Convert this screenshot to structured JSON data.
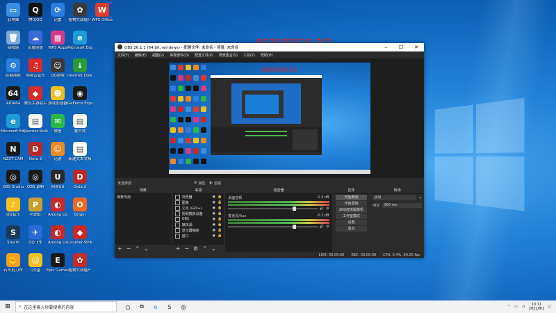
{
  "desktop": {
    "icons": [
      {
        "label": "此电脑",
        "color": "#3a8de0",
        "glyph": "▭",
        "col": 0,
        "row": 0
      },
      {
        "label": "腾讯QQ",
        "color": "#111111",
        "glyph": "Q",
        "col": 1,
        "row": 0
      },
      {
        "label": "迅雷",
        "color": "#2a7de1",
        "glyph": "⟳",
        "col": 2,
        "row": 0
      },
      {
        "label": "植物大战僵尸",
        "color": "#3a3a3a",
        "glyph": "✿",
        "col": 3,
        "row": 0
      },
      {
        "label": "WPS Office",
        "color": "#e03a2f",
        "glyph": "W",
        "col": 4,
        "row": 0
      },
      {
        "label": "回收站",
        "color": "#7aa8d8",
        "glyph": "🗑",
        "col": 0,
        "row": 1
      },
      {
        "label": "百度网盘",
        "color": "#3a6ad8",
        "glyph": "☁",
        "col": 1,
        "row": 1
      },
      {
        "label": "WPS Apps",
        "color": "#d83a8a",
        "glyph": "▦",
        "col": 2,
        "row": 1
      },
      {
        "label": "Microsoft Edge",
        "color": "#1f9ad8",
        "glyph": "e",
        "col": 3,
        "row": 1
      },
      {
        "label": "控制面板",
        "color": "#2a7de1",
        "glyph": "⚙",
        "col": 0,
        "row": 2
      },
      {
        "label": "网易云音乐",
        "color": "#d82a2a",
        "glyph": "♫",
        "col": 1,
        "row": 2
      },
      {
        "label": "QQ游戏",
        "color": "#3a3a3a",
        "glyph": "☺",
        "col": 2,
        "row": 2
      },
      {
        "label": "Internet Download",
        "color": "#2a9a3a",
        "glyph": "↓",
        "col": 3,
        "row": 2
      },
      {
        "label": "AIDA64",
        "color": "#1a1a1a",
        "glyph": "64",
        "col": 0,
        "row": 3
      },
      {
        "label": "腾讯手游助手",
        "color": "#d82a2a",
        "glyph": "◆",
        "col": 1,
        "row": 3
      },
      {
        "label": "游戏加速器",
        "color": "#f0c020",
        "glyph": "☻",
        "col": 2,
        "row": 3
      },
      {
        "label": "GeForce Experience",
        "color": "#1a1a1a",
        "glyph": "◉",
        "col": 3,
        "row": 3
      },
      {
        "label": "Microsoft Edge",
        "color": "#1f9ad8",
        "glyph": "e",
        "col": 0,
        "row": 4
      },
      {
        "label": "Counter-Strike",
        "color": "#ffffff",
        "glyph": "▤",
        "col": 1,
        "row": 4
      },
      {
        "label": "微信",
        "color": "#2ab84a",
        "glyph": "✉",
        "col": 2,
        "row": 4
      },
      {
        "label": "鲁大师",
        "color": "#ffffff",
        "glyph": "▤",
        "col": 3,
        "row": 4
      },
      {
        "label": "NZXT CAM",
        "color": "#1a1a1a",
        "glyph": "N",
        "col": 0,
        "row": 5
      },
      {
        "label": "Dota 2",
        "color": "#b82a2a",
        "glyph": "D",
        "col": 1,
        "row": 5
      },
      {
        "label": "迅游",
        "color": "#f08a20",
        "glyph": "☺",
        "col": 2,
        "row": 5
      },
      {
        "label": "新建文本文档",
        "color": "#ffffff",
        "glyph": "▤",
        "col": 3,
        "row": 5
      },
      {
        "label": "OBS Studio",
        "color": "#1a1a1a",
        "glyph": "◎",
        "col": 0,
        "row": 6
      },
      {
        "label": "OBS 录制",
        "color": "#1a1a1a",
        "glyph": "◎",
        "col": 1,
        "row": 6
      },
      {
        "label": "网易UU",
        "color": "#2a2a2a",
        "glyph": "U",
        "col": 2,
        "row": 6
      },
      {
        "label": "Dota 2",
        "color": "#b82a2a",
        "glyph": "D",
        "col": 3,
        "row": 6
      },
      {
        "label": "QQ音乐",
        "color": "#f0c020",
        "glyph": "♪",
        "col": 0,
        "row": 7
      },
      {
        "label": "PUBG",
        "color": "#c8a030",
        "glyph": "P",
        "col": 1,
        "row": 7
      },
      {
        "label": "Among Us",
        "color": "#c82a2a",
        "glyph": "◐",
        "col": 2,
        "row": 7
      },
      {
        "label": "Origin",
        "color": "#f06a20",
        "glyph": "O",
        "col": 3,
        "row": 7
      },
      {
        "label": "Steam",
        "color": "#1a3a5a",
        "glyph": "S",
        "col": 0,
        "row": 8
      },
      {
        "label": "QQ飞车",
        "color": "#2a6ad8",
        "glyph": "✈",
        "col": 1,
        "row": 8
      },
      {
        "label": "Among Us",
        "color": "#c82a2a",
        "glyph": "◐",
        "col": 2,
        "row": 8
      },
      {
        "label": "Counter-Strike",
        "color": "#c82a2a",
        "glyph": "◆",
        "col": 3,
        "row": 8
      },
      {
        "label": "石头剪刀布",
        "color": "#f0a020",
        "glyph": "✊",
        "col": 0,
        "row": 9
      },
      {
        "label": "QQ堂",
        "color": "#f0c020",
        "glyph": "☺",
        "col": 1,
        "row": 9
      },
      {
        "label": "Epic Games",
        "color": "#1a1a1a",
        "glyph": "E",
        "col": 2,
        "row": 9
      },
      {
        "label": "植物大战僵尸",
        "color": "#c82a2a",
        "glyph": "✿",
        "col": 3,
        "row": 9
      }
    ]
  },
  "counter_text": "8930/9500 3/2",
  "obs": {
    "title": "OBS 26.1.1 (64 bit, windows) - 配置文件: 未命名 - 场景: 未命名",
    "menu": [
      "文件(F)",
      "编辑(E)",
      "视图(V)",
      "停靠部件(D)",
      "配置文件(P)",
      "场景集合(S)",
      "工具(T)",
      "帮助(H)"
    ],
    "status_label": "未选择源",
    "prop_label": "属性",
    "filter_label": "滤镜",
    "docks": {
      "scenes": {
        "title": "场景",
        "items": [
          "场景专用"
        ]
      },
      "sources": {
        "title": "来源",
        "items": [
          "浏览器",
          "图像",
          "文本 (GDI+)",
          "视频捕获设备",
          "OBS",
          "媒体源",
          "显示器捕获",
          "窗口"
        ]
      },
      "mixer": {
        "title": "混音器",
        "channels": [
          {
            "name": "桌面音频",
            "db": "-1.9 dB"
          },
          {
            "name": "麦克风/Aux",
            "db": "-0.2 dB"
          }
        ]
      },
      "transitions": {
        "title": "转场",
        "type": "淡出",
        "duration_label": "时长",
        "duration": "300 ms"
      },
      "controls": {
        "title": "控件",
        "buttons": [
          "开始推流",
          "开始录制",
          "启动虚拟摄像机",
          "工作室模式",
          "设置",
          "退出"
        ]
      }
    },
    "statusbar": {
      "live": "LIVE: 00:00:00",
      "rec": "REC: 00:00:00",
      "cpu": "CPU: 0.4%, 60.00 fps"
    }
  },
  "taskbar": {
    "search_placeholder": "在这里输入你要搜索的内容",
    "time": "10:11",
    "date": "2021/8/1"
  }
}
